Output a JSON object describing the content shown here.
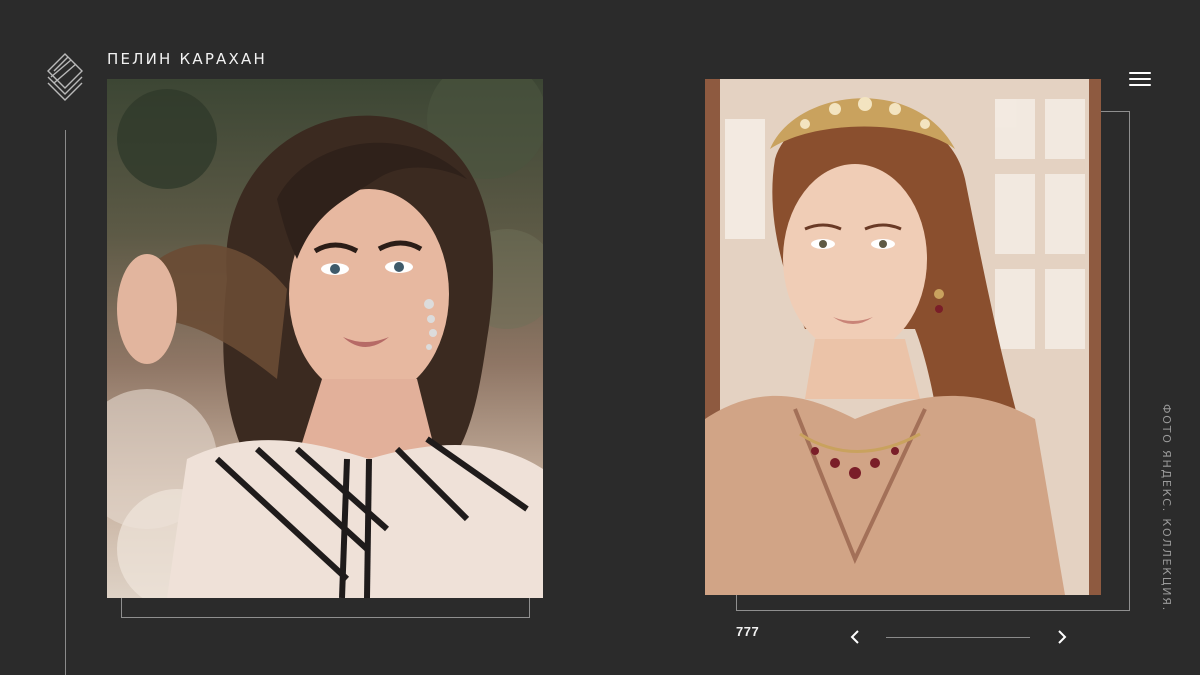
{
  "header": {
    "title": "ПЕЛИН КАРАХАН",
    "logo_icon": "diamond-stack-logo-icon"
  },
  "menu": {
    "icon": "hamburger-menu-icon"
  },
  "photos": {
    "left": {
      "icon": "portrait-photo"
    },
    "right": {
      "icon": "portrait-photo"
    }
  },
  "caption": {
    "text": "ФОТО ЯНДЕКС. КОЛЛЕКЦИЯ."
  },
  "slider": {
    "counter": "777",
    "prev_icon": "chevron-left-icon",
    "next_icon": "chevron-right-icon"
  },
  "colors": {
    "background": "#2b2b2b",
    "line": "#8a8a8a",
    "text": "#ffffff",
    "caption": "#9a9a9a"
  }
}
